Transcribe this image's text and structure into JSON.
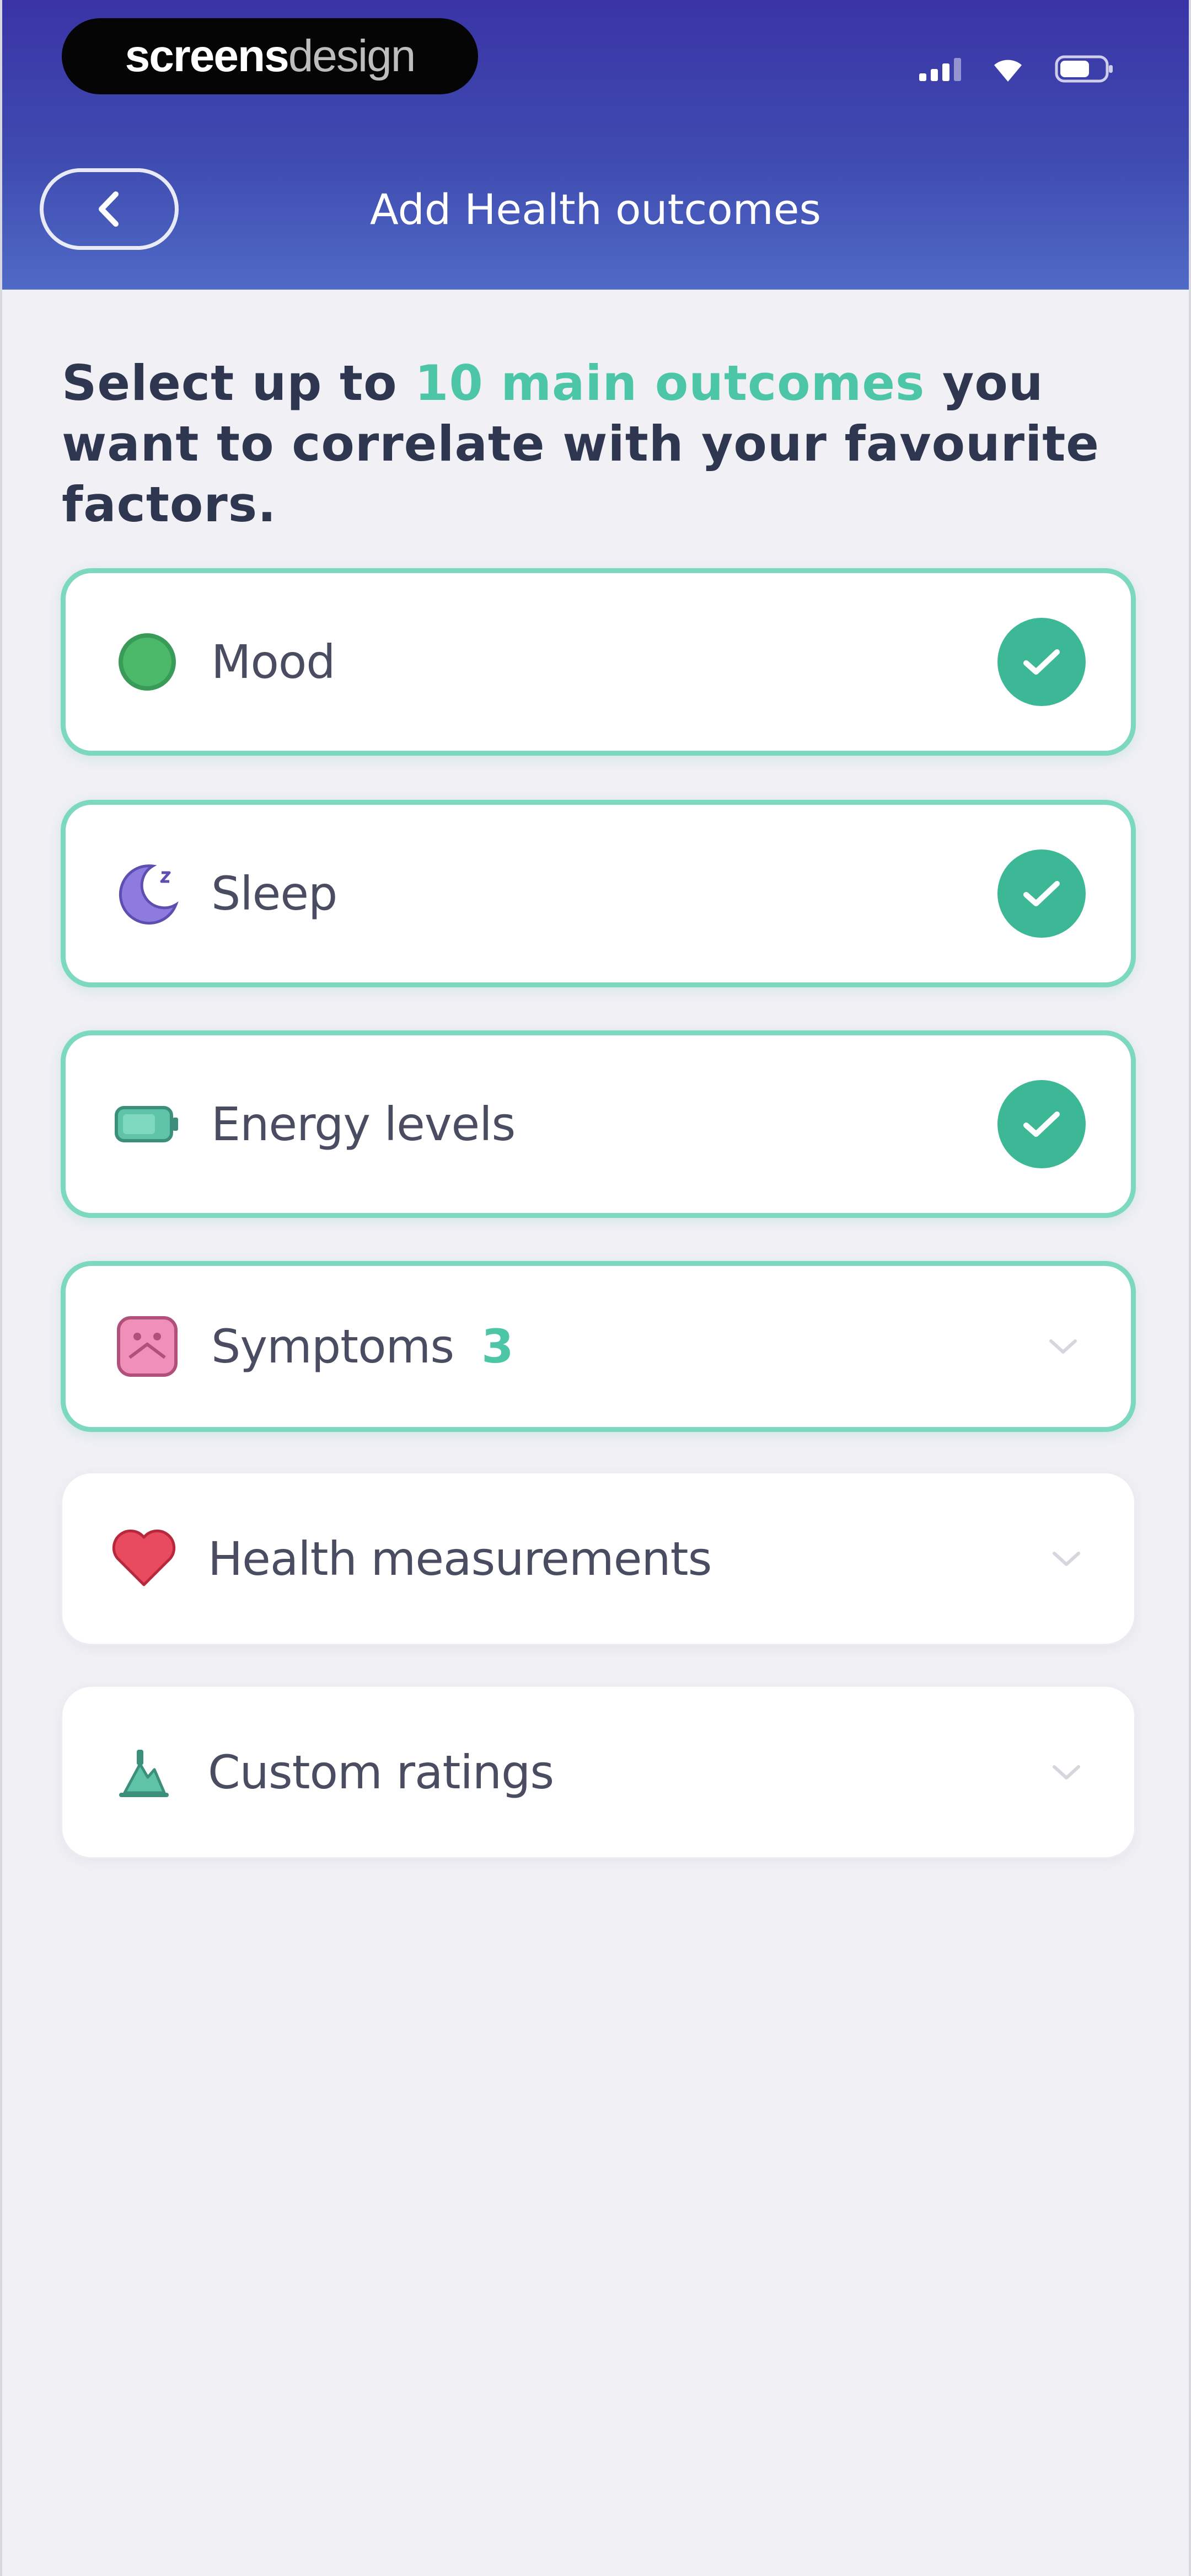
{
  "status_bar": {
    "brand_bold": "screens",
    "brand_light": "design"
  },
  "header": {
    "title": "Add Health outcomes"
  },
  "instruction": {
    "prefix": "Select up to ",
    "highlight": "10 main outcomes",
    "suffix": " you want to correlate with your favourite factors."
  },
  "outcomes": [
    {
      "label": "Mood",
      "icon": "mood-icon",
      "selected": true
    },
    {
      "label": "Sleep",
      "icon": "moon-icon",
      "selected": true
    },
    {
      "label": "Energy levels",
      "icon": "battery-icon",
      "selected": true
    },
    {
      "label": "Symptoms",
      "count": "3",
      "icon": "symptoms-icon",
      "selected": true,
      "expandable": true
    },
    {
      "label": "Health measurements",
      "icon": "heart-icon",
      "selected": false,
      "expandable": true
    },
    {
      "label": "Custom ratings",
      "icon": "custom-rating-icon",
      "selected": false,
      "expandable": true
    }
  ],
  "colors": {
    "accent": "#4cc6a6",
    "check_fill": "#3db896",
    "header_top": "#3a34a6",
    "header_bottom": "#4f6ac6",
    "text_dark": "#2f3650",
    "background": "#f0f0f5"
  }
}
